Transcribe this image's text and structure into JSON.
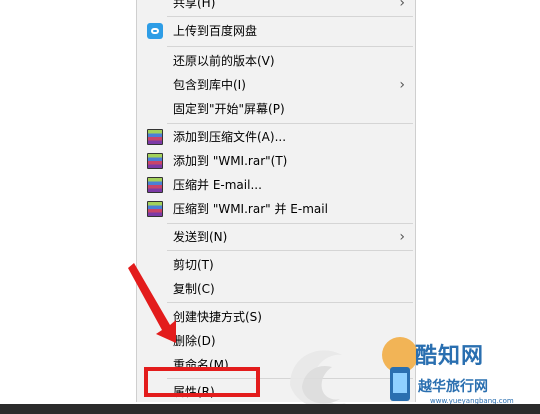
{
  "context_menu": {
    "items": [
      {
        "label": "共享(H)",
        "icon": "share",
        "submenu": true
      },
      {
        "label": "上传到百度网盘",
        "icon": "baidu-netdisk-icon",
        "submenu": false
      },
      {
        "label": "还原以前的版本(V)",
        "icon": "",
        "submenu": false
      },
      {
        "label": "包含到库中(I)",
        "icon": "",
        "submenu": true
      },
      {
        "label": "固定到\"开始\"屏幕(P)",
        "icon": "",
        "submenu": false
      },
      {
        "label": "添加到压缩文件(A)...",
        "icon": "winrar-icon",
        "submenu": false
      },
      {
        "label": "添加到 \"WMI.rar\"(T)",
        "icon": "winrar-icon",
        "submenu": false
      },
      {
        "label": "压缩并 E-mail...",
        "icon": "winrar-icon",
        "submenu": false
      },
      {
        "label": "压缩到 \"WMI.rar\" 并 E-mail",
        "icon": "winrar-icon",
        "submenu": false
      },
      {
        "label": "发送到(N)",
        "icon": "",
        "submenu": true
      },
      {
        "label": "剪切(T)",
        "icon": "",
        "submenu": false
      },
      {
        "label": "复制(C)",
        "icon": "",
        "submenu": false
      },
      {
        "label": "创建快捷方式(S)",
        "icon": "",
        "submenu": false
      },
      {
        "label": "删除(D)",
        "icon": "",
        "submenu": false
      },
      {
        "label": "重命名(M)",
        "icon": "",
        "submenu": false
      },
      {
        "label": "属性(R)",
        "icon": "",
        "submenu": false
      }
    ],
    "submenu_glyph": "›"
  },
  "watermark": {
    "title": "酷知网",
    "subtitle": "越华旅行网",
    "url": "www.yueyangbang.com"
  },
  "annotations": {
    "highlight_color": "#e31c1c",
    "highlighted_item": "属性(R)"
  }
}
